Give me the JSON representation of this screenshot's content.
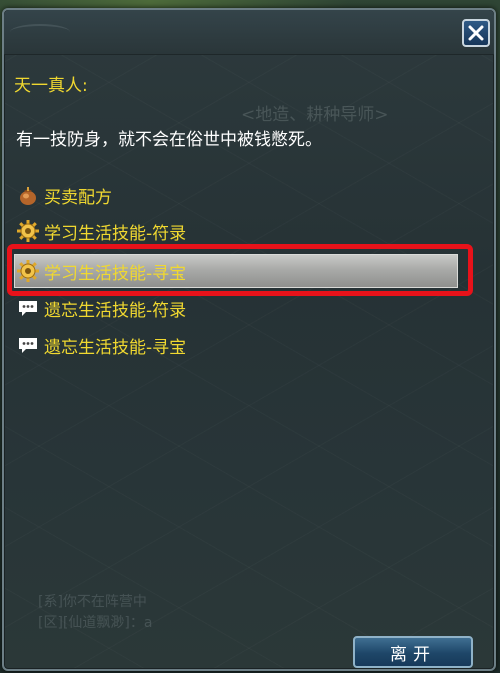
{
  "dialog": {
    "npc_name": "天一真人:",
    "npc_text": "有一技防身，就不会在俗世中被钱憋死。",
    "background_text": "<地造、耕种导师>",
    "options": [
      {
        "label": "买卖配方",
        "icon": "bag-icon"
      },
      {
        "label": "学习生活技能-符录",
        "icon": "gear-icon"
      },
      {
        "label": "学习生活技能-寻宝",
        "icon": "gear-icon",
        "selected": true
      },
      {
        "label": "遗忘生活技能-符录",
        "icon": "speech-bubble-icon"
      },
      {
        "label": "遗忘生活技能-寻宝",
        "icon": "speech-bubble-icon"
      }
    ],
    "leave_label": "离开",
    "close_icon": "close-icon"
  },
  "chat": {
    "lines": [
      "[系]你不在阵营中",
      "[区][仙道飘渺]：a"
    ]
  },
  "colors": {
    "option_text": "#f0d830",
    "highlight_border": "#e8121a",
    "button_blue": "#1e4668"
  }
}
